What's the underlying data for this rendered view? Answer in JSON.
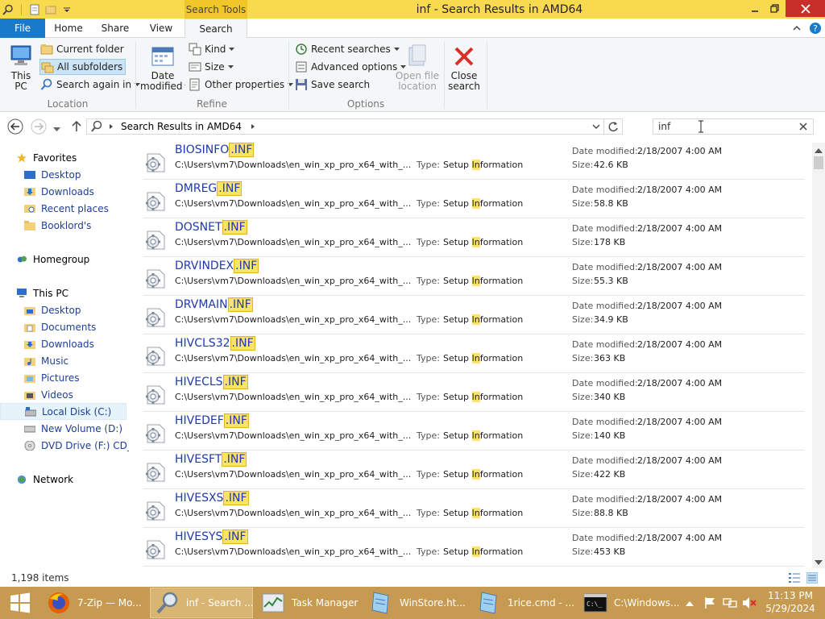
{
  "window": {
    "title": "inf - Search Results in AMD64",
    "contextual_tab_group": "Search Tools"
  },
  "ribbon_tabs": [
    "File",
    "Home",
    "Share",
    "View",
    "Search"
  ],
  "ribbon": {
    "location": {
      "label": "Location",
      "this_pc": [
        "This",
        "PC"
      ],
      "current_folder": "Current folder",
      "all_subfolders": "All subfolders",
      "search_again_in": "Search again in"
    },
    "refine": {
      "label": "Refine",
      "date_modified": [
        "Date",
        "modified"
      ],
      "kind": "Kind",
      "size": "Size",
      "other_properties": "Other properties"
    },
    "options": {
      "label": "Options",
      "recent_searches": "Recent searches",
      "advanced_options": "Advanced options",
      "save_search": "Save search",
      "open_file_location": [
        "Open file",
        "location"
      ],
      "close_search": [
        "Close",
        "search"
      ]
    }
  },
  "address": {
    "location": "Search Results in AMD64",
    "search_query": "inf"
  },
  "nav_pane": {
    "favorites": "Favorites",
    "favorites_items": [
      "Desktop",
      "Downloads",
      "Recent places",
      "Booklord's"
    ],
    "homegroup": "Homegroup",
    "this_pc": "This PC",
    "this_pc_items": [
      "Desktop",
      "Documents",
      "Downloads",
      "Music",
      "Pictures",
      "Videos",
      "Local Disk (C:)",
      "New Volume (D:)",
      "DVD Drive (F:) CD_R("
    ],
    "network": "Network"
  },
  "result_labels": {
    "type": "Type:",
    "date_modified": "Date modified:",
    "size": "Size:",
    "type_pre": "Setup ",
    "type_hl": "In",
    "type_post": "formation"
  },
  "results": [
    {
      "base": "BIOSINFO",
      "ext": ".INF",
      "path": "C:\\Users\\vm7\\Downloads\\en_win_xp_pro_x64_with_...",
      "date": "2/18/2007 4:00 AM",
      "size": "42.6 KB"
    },
    {
      "base": "DMREG",
      "ext": ".INF",
      "path": "C:\\Users\\vm7\\Downloads\\en_win_xp_pro_x64_with_...",
      "date": "2/18/2007 4:00 AM",
      "size": "58.8 KB"
    },
    {
      "base": "DOSNET",
      "ext": ".INF",
      "path": "C:\\Users\\vm7\\Downloads\\en_win_xp_pro_x64_with_...",
      "date": "2/18/2007 4:00 AM",
      "size": "178 KB"
    },
    {
      "base": "DRVINDEX",
      "ext": ".INF",
      "path": "C:\\Users\\vm7\\Downloads\\en_win_xp_pro_x64_with_...",
      "date": "2/18/2007 4:00 AM",
      "size": "55.3 KB"
    },
    {
      "base": "DRVMAIN",
      "ext": ".INF",
      "path": "C:\\Users\\vm7\\Downloads\\en_win_xp_pro_x64_with_...",
      "date": "2/18/2007 4:00 AM",
      "size": "34.9 KB"
    },
    {
      "base": "HIVCLS32",
      "ext": ".INF",
      "path": "C:\\Users\\vm7\\Downloads\\en_win_xp_pro_x64_with_...",
      "date": "2/18/2007 4:00 AM",
      "size": "363 KB"
    },
    {
      "base": "HIVECLS",
      "ext": ".INF",
      "path": "C:\\Users\\vm7\\Downloads\\en_win_xp_pro_x64_with_...",
      "date": "2/18/2007 4:00 AM",
      "size": "340 KB"
    },
    {
      "base": "HIVEDEF",
      "ext": ".INF",
      "path": "C:\\Users\\vm7\\Downloads\\en_win_xp_pro_x64_with_...",
      "date": "2/18/2007 4:00 AM",
      "size": "140 KB"
    },
    {
      "base": "HIVESFT",
      "ext": ".INF",
      "path": "C:\\Users\\vm7\\Downloads\\en_win_xp_pro_x64_with_...",
      "date": "2/18/2007 4:00 AM",
      "size": "422 KB"
    },
    {
      "base": "HIVESXS",
      "ext": ".INF",
      "path": "C:\\Users\\vm7\\Downloads\\en_win_xp_pro_x64_with_...",
      "date": "2/18/2007 4:00 AM",
      "size": "88.8 KB"
    },
    {
      "base": "HIVESYS",
      "ext": ".INF",
      "path": "C:\\Users\\vm7\\Downloads\\en_win_xp_pro_x64_with_...",
      "date": "2/18/2007 4:00 AM",
      "size": "453 KB"
    }
  ],
  "status_bar": {
    "item_count": "1,198 items"
  },
  "taskbar": {
    "buttons": [
      "7-Zip — Mo...",
      "inf - Search ...",
      "Task Manager",
      "WinStore.ht...",
      "1rice.cmd - ...",
      "C:\\Windows..."
    ],
    "time": "11:13 PM",
    "date": "5/29/2024"
  },
  "colors": {
    "title_bar": "#f9d94e",
    "file_tab": "#1979ca",
    "highlight": "#fbe36b",
    "taskbar": "#c79a51",
    "link_text": "#1f3aa8"
  }
}
